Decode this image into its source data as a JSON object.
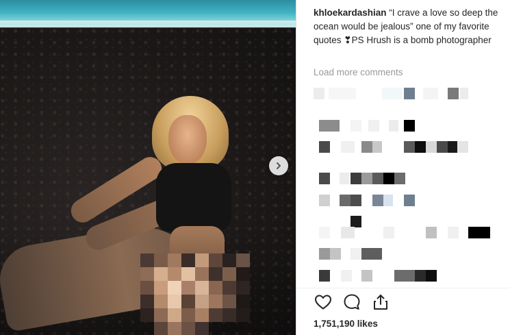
{
  "post": {
    "username": "khloekardashian",
    "caption_text": " “I crave a love so deep the ocean would be jealous” one of my favorite quotes ❣PS Hrush is a bomb photographer",
    "load_more_label": "Load more comments",
    "likes_label": "1,751,190 likes"
  },
  "icons": {
    "next": "chevron-right-icon",
    "like": "heart-icon",
    "comment": "comment-bubble-icon",
    "share": "share-icon"
  },
  "colors": {
    "text": "#262626",
    "muted": "#999999",
    "divider": "#dbdbdb"
  }
}
